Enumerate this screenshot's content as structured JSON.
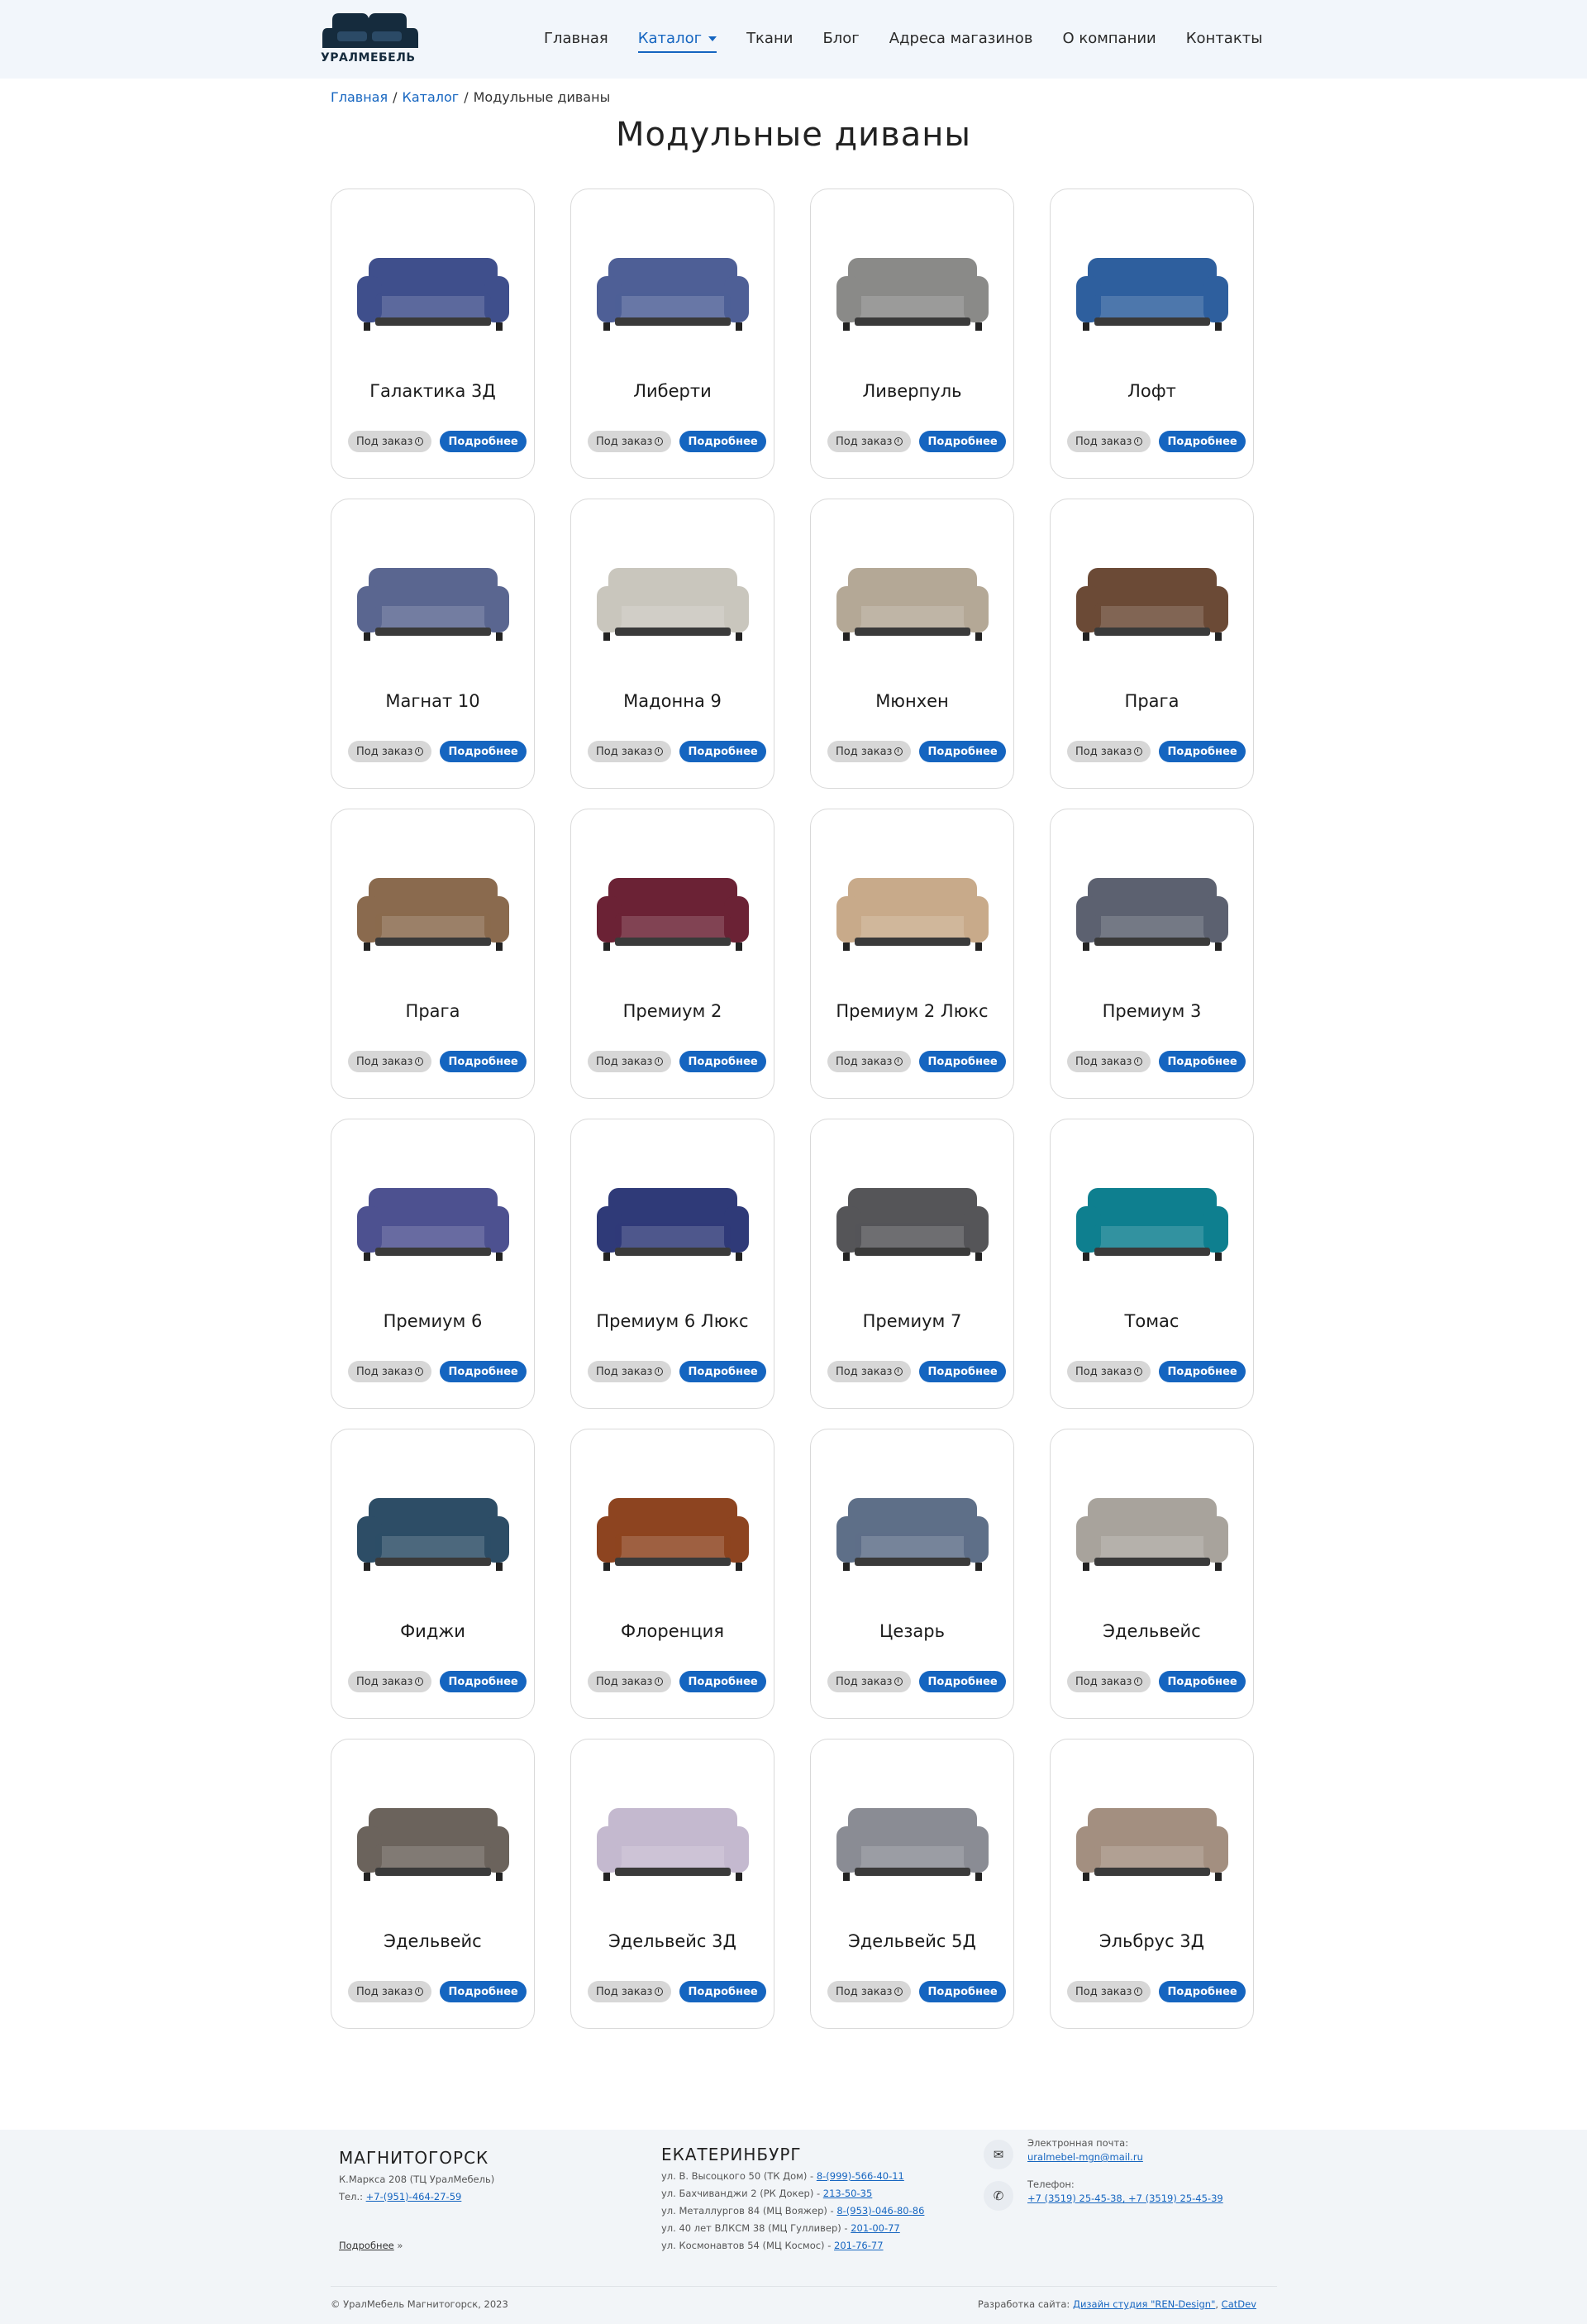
{
  "header": {
    "logo_text": "УРАЛМЕБЕЛЬ",
    "nav": [
      {
        "label": "Главная",
        "active": false
      },
      {
        "label": "Каталог",
        "active": true
      },
      {
        "label": "Ткани",
        "active": false
      },
      {
        "label": "Блог",
        "active": false
      },
      {
        "label": "Адреса магазинов",
        "active": false
      },
      {
        "label": "О компании",
        "active": false
      },
      {
        "label": "Контакты",
        "active": false
      }
    ]
  },
  "breadcrumb": {
    "home": "Главная",
    "catalog": "Каталог",
    "current": "Модульные диваны",
    "separator": "/"
  },
  "page_title": "Модульные диваны",
  "card_buttons": {
    "order": "Под заказ",
    "more": "Подробнее"
  },
  "products": [
    {
      "name": "Галактика 3Д",
      "color": "#3f4f8c"
    },
    {
      "name": "Либерти",
      "color": "#4e5f96"
    },
    {
      "name": "Ливерпуль",
      "color": "#8a8a88"
    },
    {
      "name": "Лофт",
      "color": "#2e5f9e"
    },
    {
      "name": "Магнат 10",
      "color": "#5a6690"
    },
    {
      "name": "Мадонна 9",
      "color": "#c9c6bd"
    },
    {
      "name": "Мюнхен",
      "color": "#b4a896"
    },
    {
      "name": "Прага",
      "color": "#6b4a36"
    },
    {
      "name": "Прага",
      "color": "#8a6a4e"
    },
    {
      "name": "Премиум 2",
      "color": "#6b2235"
    },
    {
      "name": "Премиум 2 Люкс",
      "color": "#c8aa8a"
    },
    {
      "name": "Премиум 3",
      "color": "#5c6170"
    },
    {
      "name": "Премиум 6",
      "color": "#4d5190"
    },
    {
      "name": "Премиум 6 Люкс",
      "color": "#2f3a78"
    },
    {
      "name": "Премиум 7",
      "color": "#555558"
    },
    {
      "name": "Томас",
      "color": "#0e7f8f"
    },
    {
      "name": "Фиджи",
      "color": "#2d4d66"
    },
    {
      "name": "Флоренция",
      "color": "#8d4420"
    },
    {
      "name": "Цезарь",
      "color": "#5e6f88"
    },
    {
      "name": "Эдельвейс",
      "color": "#a8a39c"
    },
    {
      "name": "Эдельвейс",
      "color": "#6b635c"
    },
    {
      "name": "Эдельвейс 3Д",
      "color": "#c4b9cf"
    },
    {
      "name": "Эдельвейс 5Д",
      "color": "#8a8c94"
    },
    {
      "name": "Эльбрус 3Д",
      "color": "#a38f80"
    }
  ],
  "footer": {
    "magnitogorsk": {
      "city": "МАГНИТОГОРСК",
      "address": "К.Маркса 208 (ТЦ УралМебель)",
      "tel_label": "Тел.:",
      "tel": "+7-(951)-464-27-59",
      "more": "Подробнее",
      "more_suffix": "»"
    },
    "ekaterinburg": {
      "city": "ЕКАТЕРИНБУРГ",
      "lines": [
        {
          "text": "ул. В. Высоцкого 50 (ТК Дом) - ",
          "phone": "8-(999)-566-40-11"
        },
        {
          "text": "ул. Бахчиванджи 2 (РК Докер) - ",
          "phone": "213-50-35"
        },
        {
          "text": "ул. Металлургов 84 (МЦ Вояжер) - ",
          "phone": "8-(953)-046-80-86"
        },
        {
          "text": "ул. 40 лет ВЛКСМ 38 (МЦ Гулливер) - ",
          "phone": "201-00-77"
        },
        {
          "text": "ул. Космонавтов 54 (МЦ Космос) - ",
          "phone": "201-76-77"
        }
      ]
    },
    "email_label": "Электронная почта:",
    "email": "uralmebel-mgn@mail.ru",
    "phone_label": "Телефон:",
    "phones": "+7 (3519) 25-45-38, +7 (3519) 25-45-39",
    "copyright": "© УралМебель Магнитогорск, 2023",
    "dev_label": "Разработка сайта:",
    "dev_studio": "Дизайн студия \"REN-Design\"",
    "dev_sep": ",",
    "dev_cat": "CatDev"
  }
}
